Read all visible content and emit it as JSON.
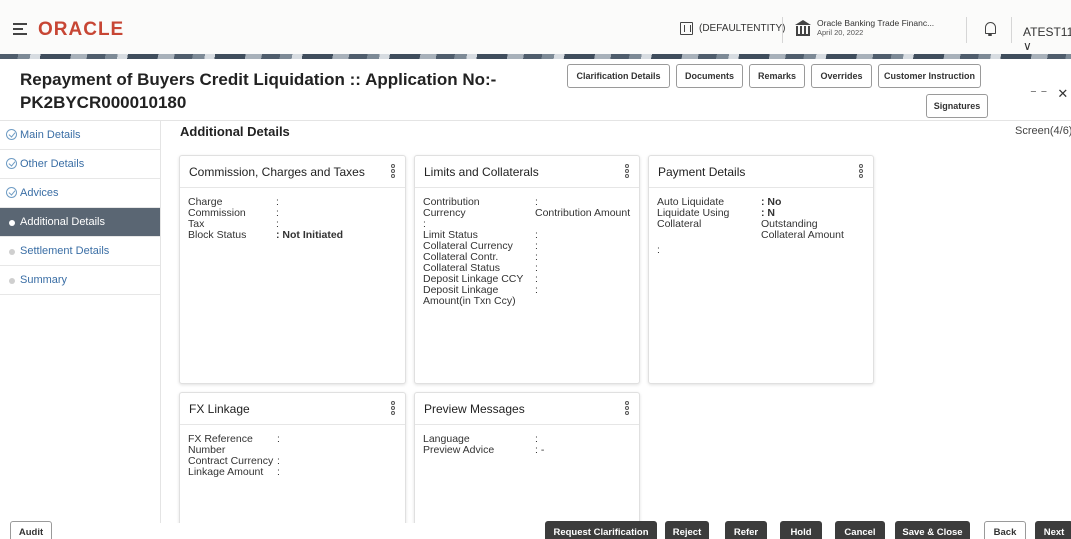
{
  "topbar": {
    "logo": "ORACLE",
    "entity": "(DEFAULTENTITY)",
    "bank_name": "Oracle Banking Trade Financ...",
    "bank_date": "April 20, 2022",
    "user": "ATEST11 ∨"
  },
  "header": {
    "title_line1": "Repayment of Buyers Credit Liquidation :: Application No:-",
    "title_line2": "PK2BYCR000010180",
    "buttons": [
      "Clarification Details",
      "Documents",
      "Remarks",
      "Overrides",
      "Customer Instruction",
      "Signatures"
    ],
    "minimize_icon": "⁻ ⁻",
    "close_icon": "✕"
  },
  "sidebar": {
    "items": [
      {
        "label": "Main Details",
        "state": "done"
      },
      {
        "label": "Other Details",
        "state": "done"
      },
      {
        "label": "Advices",
        "state": "done"
      },
      {
        "label": "Additional Details",
        "state": "active"
      },
      {
        "label": "Settlement Details",
        "state": "pending"
      },
      {
        "label": "Summary",
        "state": "pending"
      }
    ]
  },
  "main": {
    "section_title": "Additional Details",
    "screen": "Screen(4/6)",
    "cards": {
      "commission": {
        "title": "Commission, Charges and Taxes",
        "rows": [
          {
            "k": "Charge",
            "v": ":"
          },
          {
            "k": "Commission",
            "v": ":"
          },
          {
            "k": "Tax",
            "v": ":"
          },
          {
            "k": "Block Status",
            "v": ": Not Initiated"
          }
        ]
      },
      "limits": {
        "title": "Limits and Collaterals",
        "rows": [
          {
            "k": "Contribution",
            "v": ":"
          },
          {
            "k": "Currency",
            "v": "Contribution Amount"
          },
          {
            "k": ":",
            "v": ""
          },
          {
            "k": "Limit Status",
            "v": ":"
          },
          {
            "k": "Collateral Currency",
            "v": ":"
          },
          {
            "k": "Collateral Contr.",
            "v": ":"
          },
          {
            "k": "Collateral Status",
            "v": ":"
          },
          {
            "k": "Deposit Linkage CCY",
            "v": ":"
          },
          {
            "k": "Deposit Linkage",
            "v": ":"
          },
          {
            "k": "Amount(in Txn Ccy)",
            "v": ""
          }
        ]
      },
      "payment": {
        "title": "Payment Details",
        "rows": [
          {
            "k": "Auto Liquidate",
            "v": ": No"
          },
          {
            "k": "Liquidate Using",
            "v": ": N"
          },
          {
            "k": "Collateral",
            "v": "Outstanding"
          },
          {
            "k": "",
            "v": "Collateral Amount"
          },
          {
            "k": "",
            "v": ""
          },
          {
            "k": ":",
            "v": ""
          }
        ]
      },
      "fx": {
        "title": "FX Linkage",
        "rows": [
          {
            "k": "FX Reference Number",
            "v": ":"
          },
          {
            "k": "Contract Currency",
            "v": ":"
          },
          {
            "k": "Linkage Amount",
            "v": ":"
          }
        ]
      },
      "preview": {
        "title": "Preview Messages",
        "rows": [
          {
            "k": "Language",
            "v": ":"
          },
          {
            "k": "Preview Advice",
            "v": ": -"
          }
        ]
      }
    }
  },
  "footer": {
    "audit": "Audit",
    "buttons": [
      "Request Clarification",
      "Reject",
      "Refer",
      "Hold",
      "Cancel",
      "Save & Close",
      "Back",
      "Next"
    ]
  }
}
